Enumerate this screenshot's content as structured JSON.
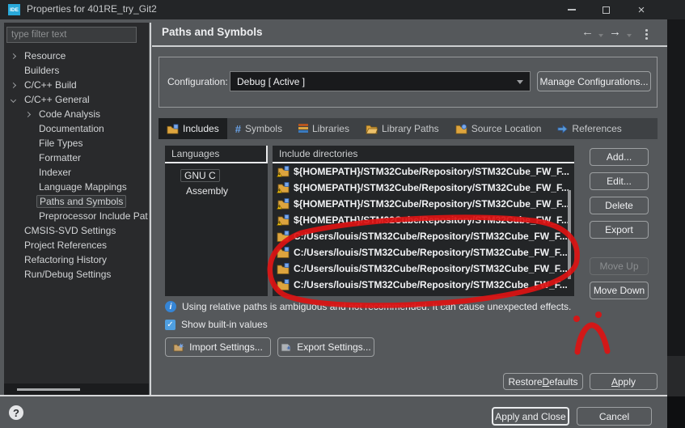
{
  "window": {
    "logo_text": "IDE",
    "title": "Properties for 401RE_try_Git2"
  },
  "sidebar": {
    "filter_placeholder": "type filter text",
    "tree": [
      "Resource",
      "Builders",
      "C/C++ Build",
      "C/C++ General",
      "Code Analysis",
      "Documentation",
      "File Types",
      "Formatter",
      "Indexer",
      "Language Mappings",
      "Paths and Symbols",
      "Preprocessor Include Pat",
      "CMSIS-SVD Settings",
      "Project References",
      "Refactoring History",
      "Run/Debug Settings"
    ]
  },
  "header": {
    "title": "Paths and Symbols"
  },
  "config": {
    "label": "Configuration:",
    "value": "Debug  [ Active ]",
    "manage_button": "Manage Configurations..."
  },
  "tabs": [
    "Includes",
    "Symbols",
    "Libraries",
    "Library Paths",
    "Source Location",
    "References"
  ],
  "languages": {
    "header": "Languages",
    "items": [
      "GNU C",
      "Assembly"
    ]
  },
  "includes": {
    "header": "Include directories",
    "rows": [
      "${HOMEPATH}/STM32Cube/Repository/STM32Cube_FW_F...",
      "${HOMEPATH}/STM32Cube/Repository/STM32Cube_FW_F...",
      "${HOMEPATH}/STM32Cube/Repository/STM32Cube_FW_F...",
      "${HOMEPATH}/STM32Cube/Repository/STM32Cube_FW_F...",
      "C:/Users/louis/STM32Cube/Repository/STM32Cube_FW_F...",
      "C:/Users/louis/STM32Cube/Repository/STM32Cube_FW_F...",
      "C:/Users/louis/STM32Cube/Repository/STM32Cube_FW_F...",
      "C:/Users/louis/STM32Cube/Repository/STM32Cube_FW_F..."
    ]
  },
  "actions": {
    "add": "Add...",
    "edit": "Edit...",
    "delete": "Delete",
    "export": "Export",
    "move_up": "Move Up",
    "move_down": "Move Down"
  },
  "info": {
    "message": "Using relative paths is ambiguous and not recommended. It can cause unexpected effects."
  },
  "builtin_checkbox": {
    "label": "Show built-in values",
    "checked": true,
    "check_glyph": "✓"
  },
  "settings_buttons": {
    "import": "Import Settings...",
    "export": "Export Settings..."
  },
  "footer": {
    "restore_defaults": {
      "pre": "Restore ",
      "key": "D",
      "post": "efaults"
    },
    "apply": {
      "pre": "",
      "key": "A",
      "post": "pply"
    },
    "apply_and_close": "Apply and Close",
    "cancel": "Cancel",
    "help": "?"
  },
  "colors": {
    "accent_blue": "#29a9da",
    "annotation_red": "#dd1212",
    "selection_blue": "#4f9fe0",
    "panel_dark": "#232527",
    "dialog_gray": "#55585b"
  }
}
